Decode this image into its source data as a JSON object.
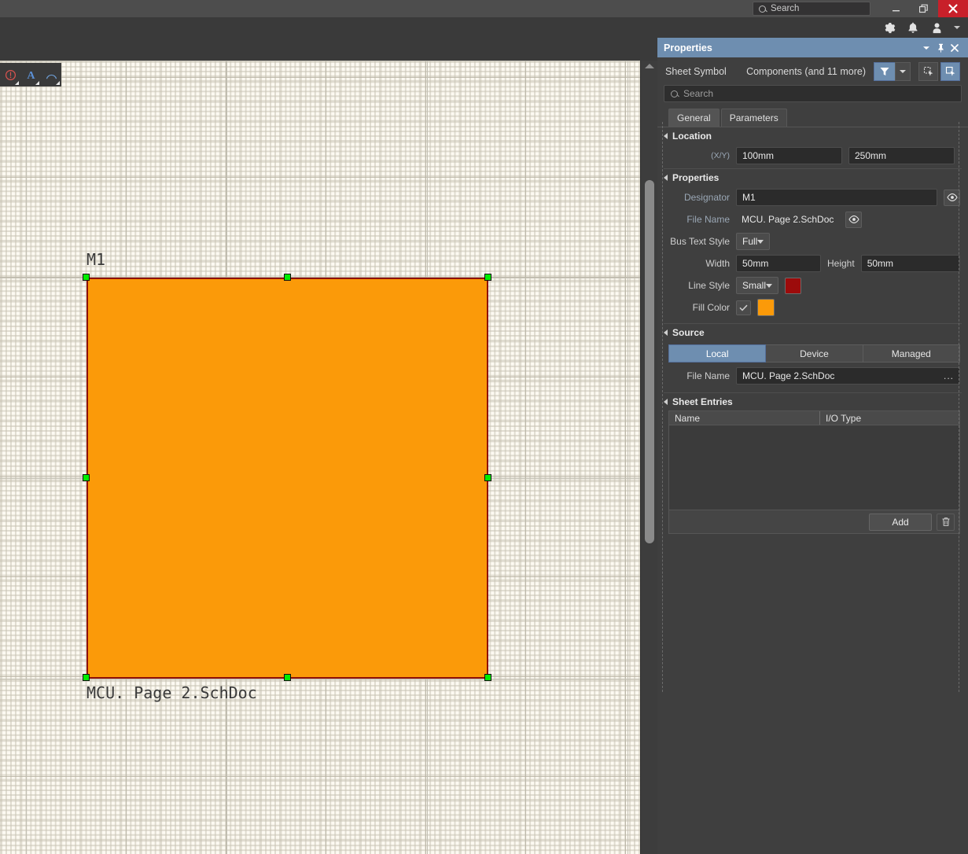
{
  "titlebar": {
    "search_placeholder": "Search",
    "minimize_label": "minimize",
    "restore_label": "restore",
    "close_label": "close"
  },
  "subbar": {
    "settings_label": "Settings",
    "notifications_label": "Notifications",
    "account_label": "Account"
  },
  "canvas": {
    "toolbar": {
      "items": [
        {
          "name": "no-entry-icon",
          "label": "No ERC"
        },
        {
          "name": "text-a-icon",
          "label": "Text"
        },
        {
          "name": "arc-icon",
          "label": "Arc"
        }
      ]
    },
    "sheet_symbol": {
      "designator": "M1",
      "file_name": "MCU. Page 2.SchDoc",
      "fill_color": "#fb9a09",
      "border_color": "#8e1005",
      "handle_color": "#00ee00"
    }
  },
  "panel": {
    "title": "Properties",
    "object_type": "Sheet Symbol",
    "object_scope": "Components (and 11 more)",
    "search_placeholder": "Search",
    "tabs": [
      {
        "label": "General",
        "active": true
      },
      {
        "label": "Parameters",
        "active": false
      }
    ],
    "location": {
      "header": "Location",
      "xy_label": "(X/Y)",
      "x": "100mm",
      "y": "250mm"
    },
    "properties": {
      "header": "Properties",
      "designator_label": "Designator",
      "designator_value": "M1",
      "file_name_label": "File Name",
      "file_name_value": "MCU. Page 2.SchDoc",
      "bus_text_style_label": "Bus Text Style",
      "bus_text_style_value": "Full",
      "width_label": "Width",
      "width_value": "50mm",
      "height_label": "Height",
      "height_value": "50mm",
      "line_style_label": "Line Style",
      "line_style_value": "Small",
      "line_color": "#9c0b0b",
      "fill_color_label": "Fill Color",
      "fill_color_checked": true,
      "fill_color": "#fb9a09"
    },
    "source": {
      "header": "Source",
      "options": [
        {
          "label": "Local",
          "active": true
        },
        {
          "label": "Device",
          "active": false
        },
        {
          "label": "Managed",
          "active": false
        }
      ],
      "file_name_label": "File Name",
      "file_name_value": "MCU. Page 2.SchDoc",
      "browse_label": "..."
    },
    "sheet_entries": {
      "header": "Sheet Entries",
      "columns": [
        "Name",
        "I/O Type"
      ],
      "rows": [],
      "add_label": "Add",
      "delete_label": "Delete"
    },
    "accent_color": "#6e8eb0"
  }
}
